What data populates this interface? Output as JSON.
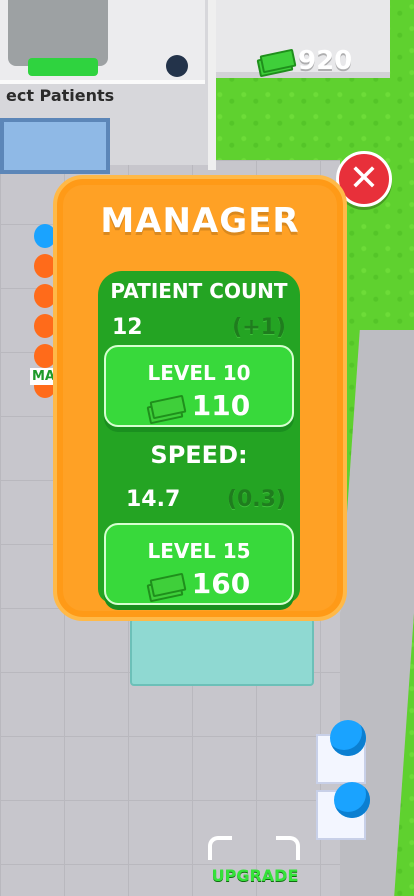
{
  "hud": {
    "money_value": "920"
  },
  "scene": {
    "room_label": "ect Patients",
    "wall_sign": "MA"
  },
  "panel": {
    "title": "MANAGER",
    "patient_count": {
      "title": "PATIENT COUNT",
      "current": "12",
      "increase": "(+1)",
      "button_level": "LEVEL 10",
      "button_cost": "110"
    },
    "speed": {
      "title": "SPEED:",
      "current": "14.7",
      "increase": "(0.3)",
      "button_level": "LEVEL 15",
      "button_cost": "160"
    }
  },
  "footer": {
    "upgrade_label": "UPGRADE"
  },
  "icons": [
    "money-stack-icon",
    "close-icon"
  ],
  "colors": {
    "panel_orange": "#ffa125",
    "stat_green": "#24a423",
    "button_green": "#38d93b",
    "close_red": "#e8303a"
  }
}
